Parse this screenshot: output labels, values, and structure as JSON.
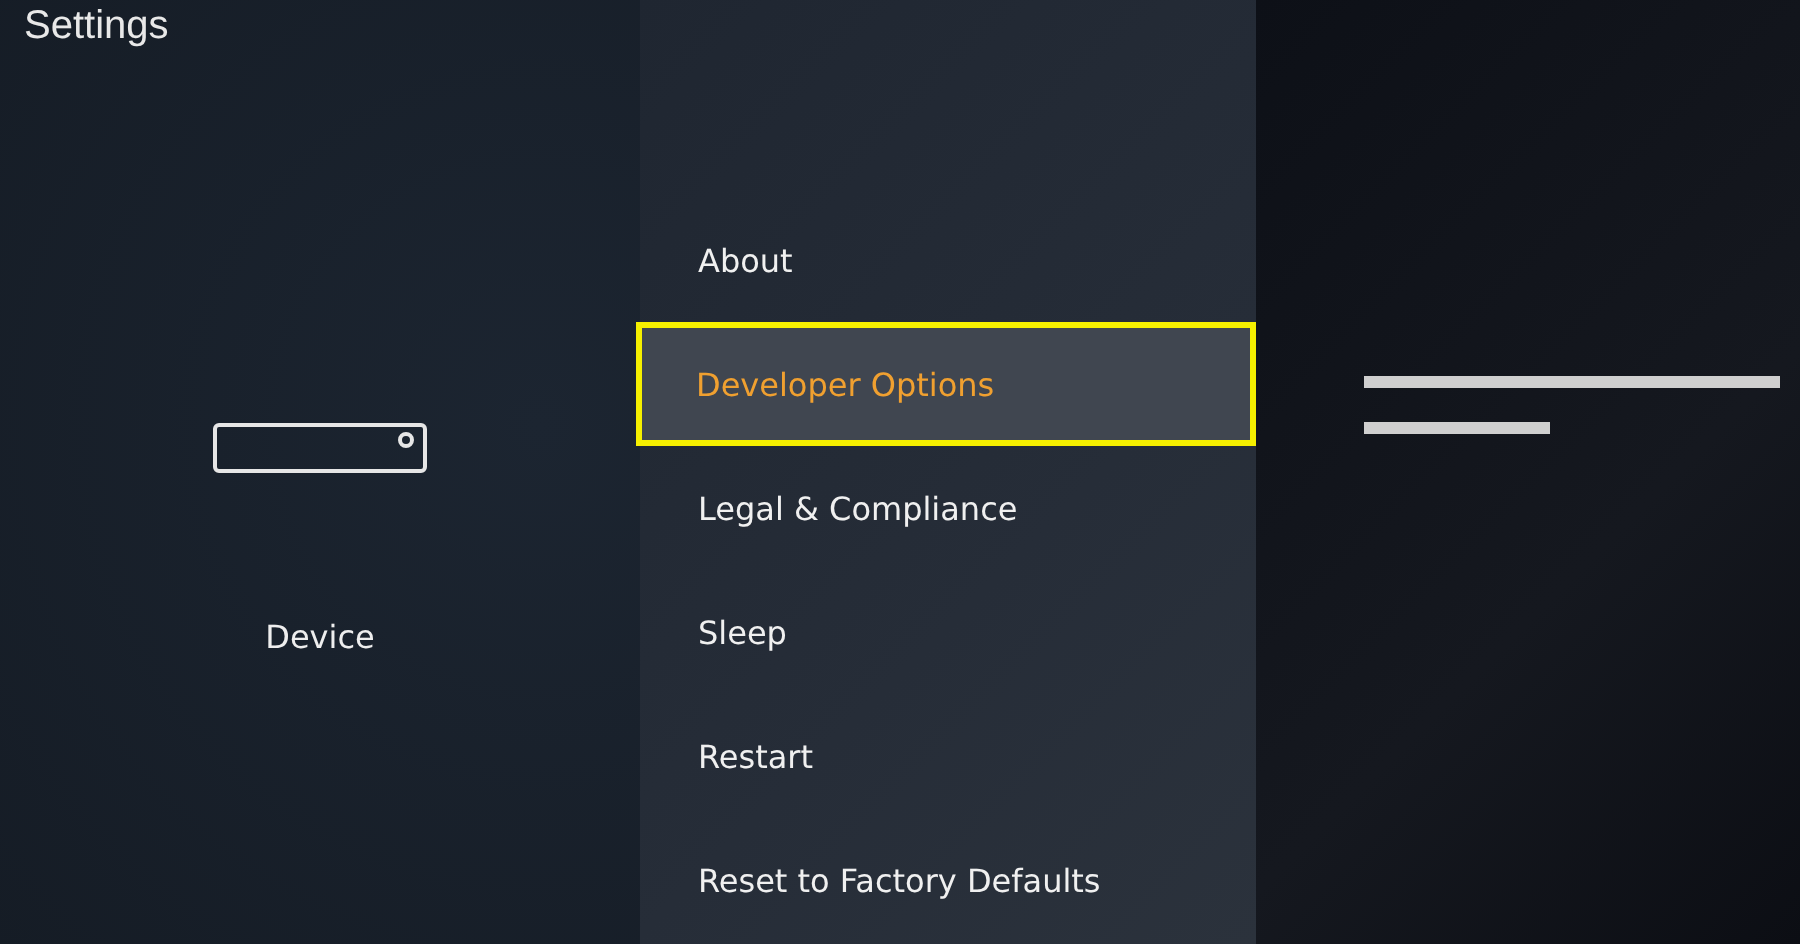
{
  "header": {
    "title": "Settings"
  },
  "category": {
    "label": "Device"
  },
  "menu": [
    {
      "label": "About",
      "selected": false
    },
    {
      "label": "Developer Options",
      "selected": true
    },
    {
      "label": "Legal & Compliance",
      "selected": false
    },
    {
      "label": "Sleep",
      "selected": false
    },
    {
      "label": "Restart",
      "selected": false
    },
    {
      "label": "Reset to Factory Defaults",
      "selected": false
    }
  ]
}
